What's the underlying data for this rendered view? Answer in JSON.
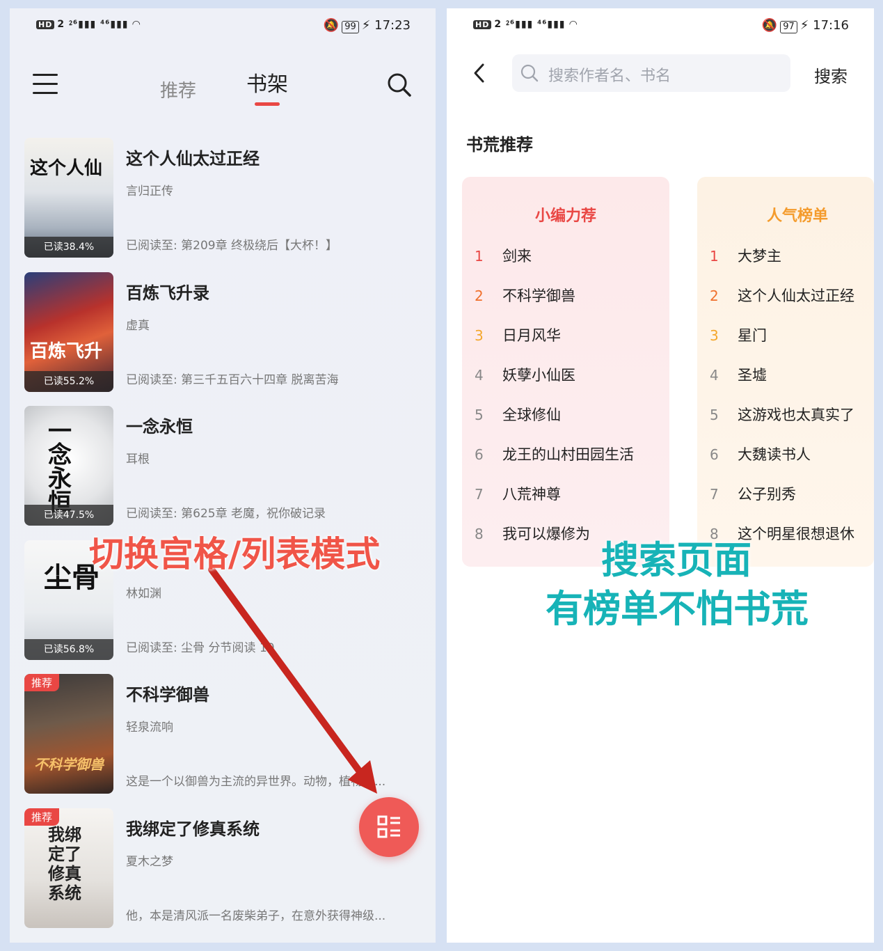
{
  "left": {
    "status": {
      "left_icons": "HD 2 26 46",
      "battery": "99",
      "time": "17:23"
    },
    "header": {
      "tab_recommend": "推荐",
      "tab_bookshelf": "书架"
    },
    "books": [
      {
        "title": "这个人仙太过正经",
        "author": "言归正传",
        "progress": "已读38.4%",
        "last_read": "已阅读至: 第209章 终极绕后【大杯！】",
        "cover_text": "这个人仙",
        "badge": ""
      },
      {
        "title": "百炼飞升录",
        "author": "虚真",
        "progress": "已读55.2%",
        "last_read": "已阅读至: 第三千五百六十四章 脱离苦海",
        "cover_text": "百炼飞升",
        "badge": ""
      },
      {
        "title": "一念永恒",
        "author": "耳根",
        "progress": "已读47.5%",
        "last_read": "已阅读至: 第625章 老魔，祝你破记录",
        "cover_text": "一念永恒",
        "badge": ""
      },
      {
        "title": "",
        "author": "林如渊",
        "progress": "已读56.8%",
        "last_read": "已阅读至: 尘骨 分节阅读 10",
        "cover_text": "尘骨",
        "badge": ""
      },
      {
        "title": "不科学御兽",
        "author": "轻泉流响",
        "progress": "",
        "last_read": "这是一个以御兽为主流的异世界。动物，植物，...",
        "cover_text": "不科学御兽",
        "badge": "推荐"
      },
      {
        "title": "我绑定了修真系统",
        "author": "夏木之梦",
        "progress": "",
        "last_read": "他，本是清风派一名废柴弟子，在意外获得神级...",
        "cover_text": "我绑定了修真系统",
        "badge": "推荐"
      }
    ],
    "overlay": "切换宫格/列表模式"
  },
  "right": {
    "status": {
      "left_icons": "HD 2 26 46",
      "battery": "97",
      "time": "17:16"
    },
    "search": {
      "placeholder": "搜索作者名、书名",
      "button": "搜索"
    },
    "section_title": "书荒推荐",
    "editor_list": {
      "title": "小编力荐",
      "items": [
        "剑来",
        "不科学御兽",
        "日月风华",
        "妖孽小仙医",
        "全球修仙",
        "龙王的山村田园生活",
        "八荒神尊",
        "我可以爆修为"
      ]
    },
    "popular_list": {
      "title": "人气榜单",
      "items": [
        "大梦主",
        "这个人仙太过正经",
        "星门",
        "圣墟",
        "这游戏也太真实了",
        "大魏读书人",
        "公子别秀",
        "这个明星很想退休"
      ]
    },
    "overlay_line1": "搜索页面",
    "overlay_line2": "有榜单不怕书荒"
  },
  "colors": {
    "accent_red": "#e94744",
    "accent_orange": "#f49b2c",
    "overlay_teal": "#17b3b7"
  }
}
